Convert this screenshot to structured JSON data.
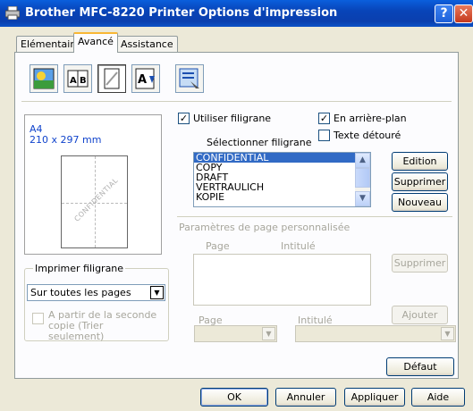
{
  "window": {
    "title": "Brother MFC-8220  Printer Options d'impression",
    "help_glyph": "?",
    "close_glyph": "✕"
  },
  "tabs": [
    {
      "label": "Elémentaire"
    },
    {
      "label": "Avancé",
      "active": true
    },
    {
      "label": "Assistance"
    }
  ],
  "toolbar_icons": [
    "color-settings-icon",
    "duplex-icon",
    "watermark-icon",
    "page-setup-icon",
    "device-options-icon"
  ],
  "preview": {
    "paper": "A4",
    "size": "210 x 297 mm",
    "watermark": "CONFIDENTIAL"
  },
  "print_watermark": {
    "legend": "Imprimer filigrane",
    "selected": "Sur toutes les pages",
    "from_second_copy": "A partir de la seconde copie (Trier seulement)",
    "from_second_copy_checked": false
  },
  "watermark": {
    "use_label": "Utiliser filigrane",
    "use_checked": true,
    "background_label": "En arrière-plan",
    "background_checked": true,
    "outline_label": "Texte détouré",
    "outline_checked": false,
    "select_label": "Sélectionner filigrane",
    "items": [
      "CONFIDENTIAL",
      "COPY",
      "DRAFT",
      "VERTRAULICH",
      "KOPIE"
    ],
    "selected_index": 0,
    "edit_label": "Edition",
    "delete_label": "Supprimer",
    "new_label": "Nouveau"
  },
  "custom_page": {
    "heading": "Paramètres de page personnalisée",
    "col_page": "Page",
    "col_title": "Intitulé",
    "delete_label": "Supprimer",
    "add_label": "Ajouter",
    "page_label": "Page",
    "title_label": "Intitulé",
    "page_value": "",
    "title_value": ""
  },
  "default_label": "Défaut",
  "footer": {
    "ok": "OK",
    "cancel": "Annuler",
    "apply": "Appliquer",
    "help": "Aide"
  },
  "colors": {
    "titlebar": "#0a46c0",
    "selection": "#316ac5",
    "active_tab_accent": "#f9b734"
  }
}
